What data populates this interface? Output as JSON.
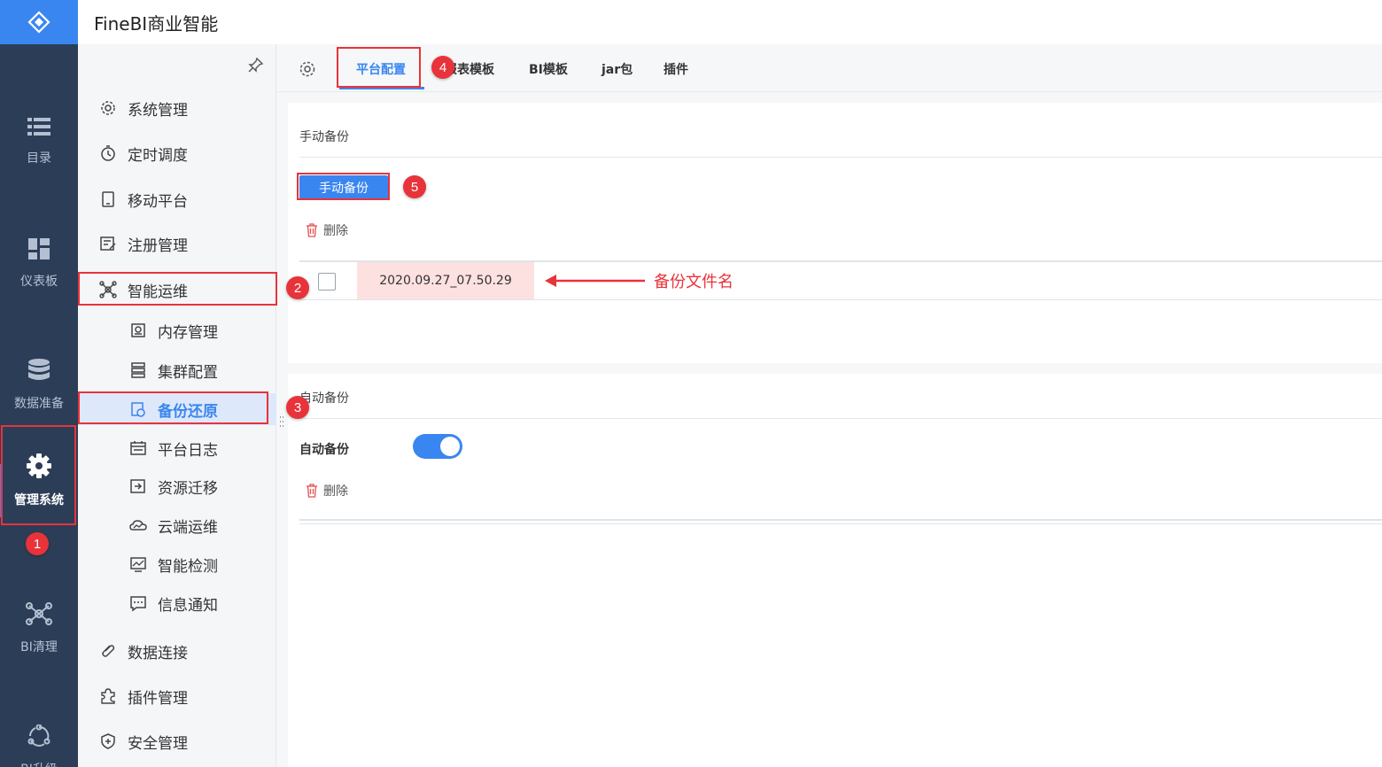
{
  "header": {
    "title": "FineBI商业智能"
  },
  "rail": {
    "items": [
      {
        "label": "目录",
        "icon": "list-icon"
      },
      {
        "label": "仪表板",
        "icon": "dashboard-icon"
      },
      {
        "label": "数据准备",
        "icon": "database-icon"
      },
      {
        "label": "管理系统",
        "icon": "gear-icon",
        "active": true
      },
      {
        "label": "BI清理",
        "icon": "network-icon"
      },
      {
        "label": "BI升级",
        "icon": "cycle-icon"
      }
    ]
  },
  "menu": {
    "items": [
      {
        "label": "系统管理",
        "icon": "gear-icon"
      },
      {
        "label": "定时调度",
        "icon": "timer-icon"
      },
      {
        "label": "移动平台",
        "icon": "tablet-icon"
      },
      {
        "label": "注册管理",
        "icon": "register-icon"
      },
      {
        "label": "智能运维",
        "icon": "ops-icon"
      },
      {
        "label": "内存管理",
        "icon": "memory-icon"
      },
      {
        "label": "集群配置",
        "icon": "cluster-icon"
      },
      {
        "label": "备份还原",
        "icon": "backup-icon",
        "active": true
      },
      {
        "label": "平台日志",
        "icon": "log-icon"
      },
      {
        "label": "资源迁移",
        "icon": "migrate-icon"
      },
      {
        "label": "云端运维",
        "icon": "cloud-icon"
      },
      {
        "label": "智能检测",
        "icon": "monitor-icon"
      },
      {
        "label": "信息通知",
        "icon": "message-icon"
      },
      {
        "label": "数据连接",
        "icon": "link-icon"
      },
      {
        "label": "插件管理",
        "icon": "plugin-icon"
      },
      {
        "label": "安全管理",
        "icon": "shield-icon"
      }
    ]
  },
  "tabs": {
    "items": [
      {
        "label": "平台配置",
        "active": true
      },
      {
        "label": "报表模板"
      },
      {
        "label": "BI模板"
      },
      {
        "label": "jar包"
      },
      {
        "label": "插件"
      }
    ]
  },
  "manual": {
    "title": "手动备份",
    "button": "手动备份",
    "delete": "删除",
    "file": "2020.09.27_07.50.29"
  },
  "auto": {
    "title": "自动备份",
    "label": "自动备份",
    "toggle_on": true,
    "delete": "删除"
  },
  "annotations": {
    "n1": "1",
    "n2": "2",
    "n3": "3",
    "n4": "4",
    "n5": "5",
    "arrow_label": "备份文件名"
  },
  "colors": {
    "accent": "#3a86f0",
    "rail": "#2c3e57",
    "annotation": "#e8333a"
  }
}
